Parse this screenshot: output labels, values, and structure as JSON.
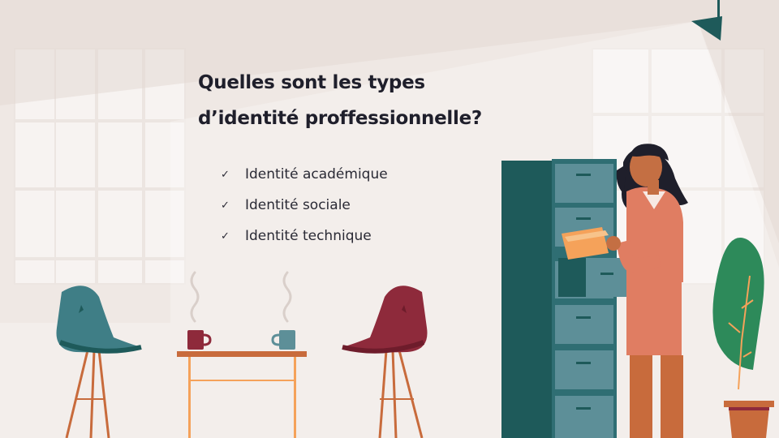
{
  "slide": {
    "title_line_1": "Quelles sont les types",
    "title_line_2": "d’identité proffessionnelle?",
    "bullet_marker": "✓",
    "bullets": [
      "Identité académique",
      "Identité sociale",
      "Identité technique"
    ]
  },
  "illustration": {
    "icons": [
      "lamp-icon",
      "chair-icon",
      "table-icon",
      "mug-icon",
      "filing-cabinet-icon",
      "person-icon",
      "folder-icon",
      "plant-icon"
    ]
  },
  "colors": {
    "background": "#efe8e4",
    "title": "#1f1f2b",
    "teal": "#1e5a5a",
    "cabinet_drawer": "#5d8f98",
    "chair_teal": "#3f7e86",
    "chair_maroon": "#8e2a3b",
    "wood": "#c86b3c",
    "suit": "#e07d62",
    "folder": "#f5a25a",
    "plant": "#2d8a5a"
  }
}
